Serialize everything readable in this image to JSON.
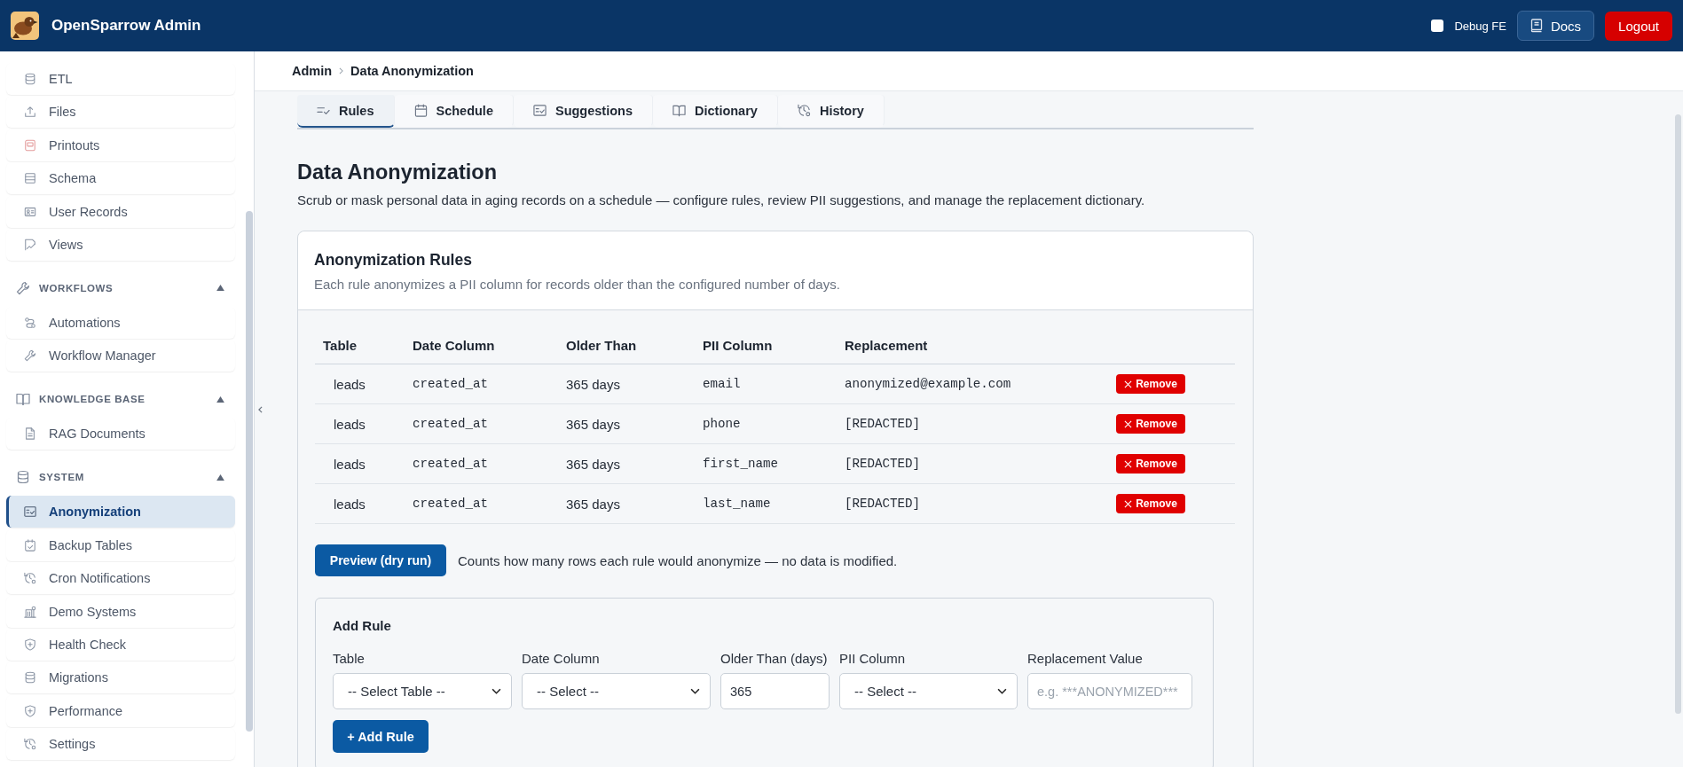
{
  "header": {
    "title": "OpenSparrow Admin",
    "debug": {
      "label": "Debug FE",
      "checked": false
    },
    "docs": "Docs",
    "logout": "Logout"
  },
  "sidebar": {
    "sections": [
      {
        "items": [
          {
            "label": "ETL",
            "selected": false
          },
          {
            "label": "Files",
            "selected": false
          },
          {
            "label": "Printouts",
            "selected": false
          },
          {
            "label": "Schema",
            "selected": false
          },
          {
            "label": "User Records",
            "selected": false
          },
          {
            "label": "Views",
            "selected": false
          }
        ]
      },
      {
        "title": "WORKFLOWS",
        "expanded": true,
        "items": [
          {
            "label": "Automations",
            "selected": false
          },
          {
            "label": "Workflow Manager",
            "selected": false
          }
        ]
      },
      {
        "title": "KNOWLEDGE BASE",
        "expanded": true,
        "items": [
          {
            "label": "RAG Documents",
            "selected": false
          }
        ]
      },
      {
        "title": "SYSTEM",
        "expanded": true,
        "items": [
          {
            "label": "Anonymization",
            "selected": true
          },
          {
            "label": "Backup Tables",
            "selected": false
          },
          {
            "label": "Cron Notifications",
            "selected": false
          },
          {
            "label": "Demo Systems",
            "selected": false
          },
          {
            "label": "Health Check",
            "selected": false
          },
          {
            "label": "Migrations",
            "selected": false
          },
          {
            "label": "Performance",
            "selected": false
          },
          {
            "label": "Settings",
            "selected": false
          }
        ]
      }
    ]
  },
  "breadcrumb": [
    "Admin",
    "Data Anonymization"
  ],
  "tabs": [
    {
      "label": "Rules",
      "selected": true
    },
    {
      "label": "Schedule",
      "selected": false
    },
    {
      "label": "Suggestions",
      "selected": false
    },
    {
      "label": "Dictionary",
      "selected": false
    },
    {
      "label": "History",
      "selected": false
    }
  ],
  "page": {
    "title": "Data Anonymization",
    "description": "Scrub or mask personal data in aging records on a schedule — configure rules, review PII suggestions, and manage the replacement dictionary."
  },
  "rules": {
    "title": "Anonymization Rules",
    "description": "Each rule anonymizes a PII column for records older than the configured number of days.",
    "columns": [
      {
        "label": "Table",
        "kind": "text"
      },
      {
        "label": "Date Column",
        "kind": "code"
      },
      {
        "label": "Older Than",
        "kind": "text"
      },
      {
        "label": "PII Column",
        "kind": "code"
      },
      {
        "label": "Replacement",
        "kind": "code"
      }
    ],
    "rows": [
      {
        "cells": [
          "leads",
          "created_at",
          "365 days",
          "email",
          "anonymized@example.com"
        ],
        "action": "Remove"
      },
      {
        "cells": [
          "leads",
          "created_at",
          "365 days",
          "phone",
          "[REDACTED]"
        ],
        "action": "Remove"
      },
      {
        "cells": [
          "leads",
          "created_at",
          "365 days",
          "first_name",
          "[REDACTED]"
        ],
        "action": "Remove"
      },
      {
        "cells": [
          "leads",
          "created_at",
          "365 days",
          "last_name",
          "[REDACTED]"
        ],
        "action": "Remove"
      }
    ]
  },
  "preview": {
    "button": "Preview (dry run)",
    "note": "Counts how many rows each rule would anonymize — no data is modified."
  },
  "add_rule": {
    "title": "Add Rule",
    "fields": [
      {
        "label": "Table",
        "kind": "select",
        "value": "-- Select Table --"
      },
      {
        "label": "Date Column",
        "kind": "select",
        "value": "-- Select --"
      },
      {
        "label": "Older Than (days)",
        "kind": "input",
        "value": "365"
      },
      {
        "label": "PII Column",
        "kind": "select",
        "value": "-- Select --"
      },
      {
        "label": "Replacement Value",
        "kind": "input",
        "placeholder": "e.g. ***ANONYMIZED***"
      }
    ],
    "button": "+ Add Rule"
  }
}
